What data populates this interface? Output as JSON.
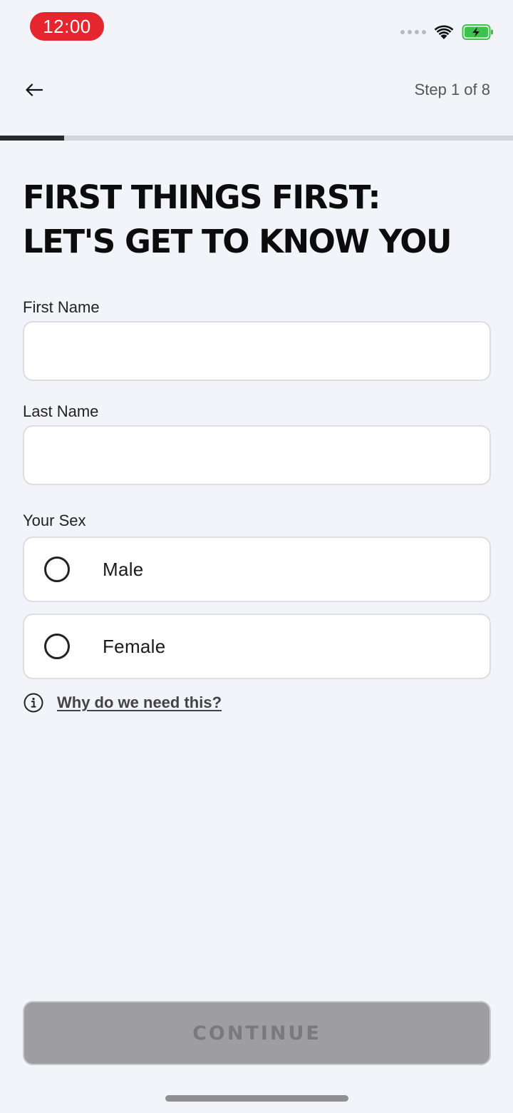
{
  "status_bar": {
    "time": "12:00",
    "time_badge_color": "#e5262e",
    "battery_color": "#3cc44a"
  },
  "header": {
    "back_icon": "arrow-left-icon",
    "step_text": "Step 1 of 8"
  },
  "progress": {
    "current_step": 1,
    "total_steps": 8,
    "fill_color": "#2b2b2f"
  },
  "title": {
    "line1": "FIRST THINGS FIRST:",
    "line2": "LET'S GET TO KNOW YOU"
  },
  "form": {
    "first_name": {
      "label": "First Name",
      "value": "",
      "placeholder": ""
    },
    "last_name": {
      "label": "Last Name",
      "value": "",
      "placeholder": ""
    },
    "sex": {
      "label": "Your Sex",
      "options": [
        {
          "label": "Male",
          "selected": false
        },
        {
          "label": "Female",
          "selected": false
        }
      ]
    },
    "info_link": "Why do we need this?",
    "info_icon": "info-icon"
  },
  "footer": {
    "continue_label": "CONTINUE",
    "continue_enabled": false
  }
}
